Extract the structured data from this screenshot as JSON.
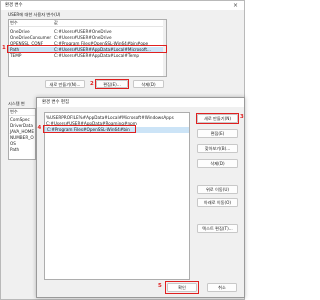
{
  "outer_dialog": {
    "title": "환경 변수",
    "close_glyph": "×",
    "user_section_label": "USER에 대한 사용자 변수(U)",
    "table_headers": {
      "variable": "변수",
      "value": "값"
    },
    "user_vars": [
      {
        "name": "OneDrive",
        "value": "C:#Users#USER#OneDrive"
      },
      {
        "name": "OneDriveConsumer",
        "value": "C:#Users#USER#OneDrive"
      },
      {
        "name": "OPENSSL_CONF",
        "value": "C:#Program Files#OpenSSL-Win64#bin#ope"
      },
      {
        "name": "Path",
        "value": "C:#Users#USER#AppData#Local#Microsoft..."
      },
      {
        "name": "TEMP",
        "value": "C:#Users#USER#AppData#Local#Temp"
      }
    ],
    "user_buttons": {
      "new": "새로 만들기(N)...",
      "edit": "편집(E)...",
      "delete": "삭제(D)"
    },
    "system_section_label": "시스템 변",
    "system_vars": [
      {
        "name": "변수"
      },
      {
        "name": "ComSpec"
      },
      {
        "name": "DriverData"
      },
      {
        "name": "JAVA_HOME"
      },
      {
        "name": "NUMBER_O"
      },
      {
        "name": "OS"
      },
      {
        "name": "Path"
      }
    ],
    "bottom_buttons": {
      "ok_label": "확인",
      "cancel_label": "취소"
    }
  },
  "inner_dialog": {
    "title": "환경 변수 편집",
    "paths": [
      "%USERPROFILE%#AppData#Local#Microsoft#WindowsApps",
      "C:#Users#USER#AppData#Roaming#npm",
      "C:#Program Files#OpenSSL-Win64#bin"
    ],
    "buttons": {
      "new": "새로 만들기(N)",
      "edit": "편집(E)",
      "browse": "찾아보기(B)...",
      "delete": "삭제(D)",
      "move_up": "위로 이동(U)",
      "move_down": "아래로 이동(O)",
      "edit_text": "텍스트 편집(T)..."
    },
    "ok_label": "확인",
    "cancel_label": "취소"
  },
  "annotations": {
    "step1": "1",
    "step2": "2",
    "step3": "3",
    "step4": "4",
    "step5": "5"
  },
  "colors": {
    "annotation_red": "#e02020",
    "selection_blue": "#cce4f7",
    "dialog_bg": "#f0f0f0"
  }
}
